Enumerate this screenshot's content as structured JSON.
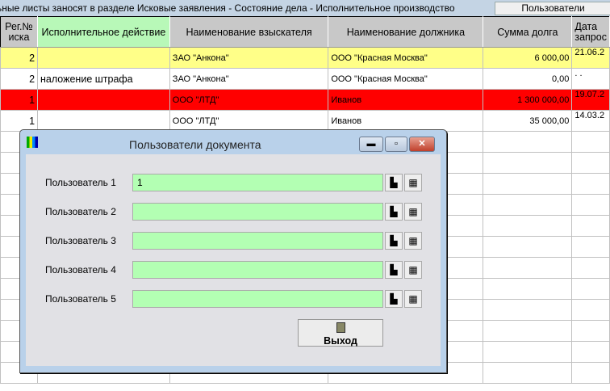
{
  "topbar": {
    "message": "ьные листы заносят в разделе Исковые заявления - Состояние дела - Исполнительное производство",
    "users_button": "Пользователи"
  },
  "table": {
    "headers": [
      "Рег.№ иска",
      "Исполнительное действие",
      "Наименование взыскателя",
      "Наименование должника",
      "Сумма долга",
      "Дата запрос"
    ],
    "rows": [
      {
        "reg": "2",
        "action": "",
        "creditor": "ЗАО \"Анкона\"",
        "debtor": "ООО \"Красная Москва\"",
        "sum": "6 000,00",
        "date": "21.06.2"
      },
      {
        "reg": "2",
        "action": "наложение штрафа",
        "creditor": "ЗАО \"Анкона\"",
        "debtor": "ООО \"Красная Москва\"",
        "sum": "0,00",
        "date": ". ."
      },
      {
        "reg": "1",
        "action": "",
        "creditor": "ООО \"ЛТД\"",
        "debtor": "Иванов",
        "sum": "1 300 000,00",
        "date": "19.07.2"
      },
      {
        "reg": "1",
        "action": "",
        "creditor": "ООО \"ЛТД\"",
        "debtor": "Иванов",
        "sum": "35 000,00",
        "date": "14.03.2"
      }
    ]
  },
  "dialog": {
    "title": "Пользователи документа",
    "fields": [
      {
        "label": "Пользователь 1",
        "value": "1"
      },
      {
        "label": "Пользователь 2",
        "value": ""
      },
      {
        "label": "Пользователь 3",
        "value": ""
      },
      {
        "label": "Пользователь 4",
        "value": ""
      },
      {
        "label": "Пользователь 5",
        "value": ""
      }
    ],
    "exit_label": "Выход",
    "minimize": "▬",
    "maximize": "▫",
    "close": "✕"
  }
}
